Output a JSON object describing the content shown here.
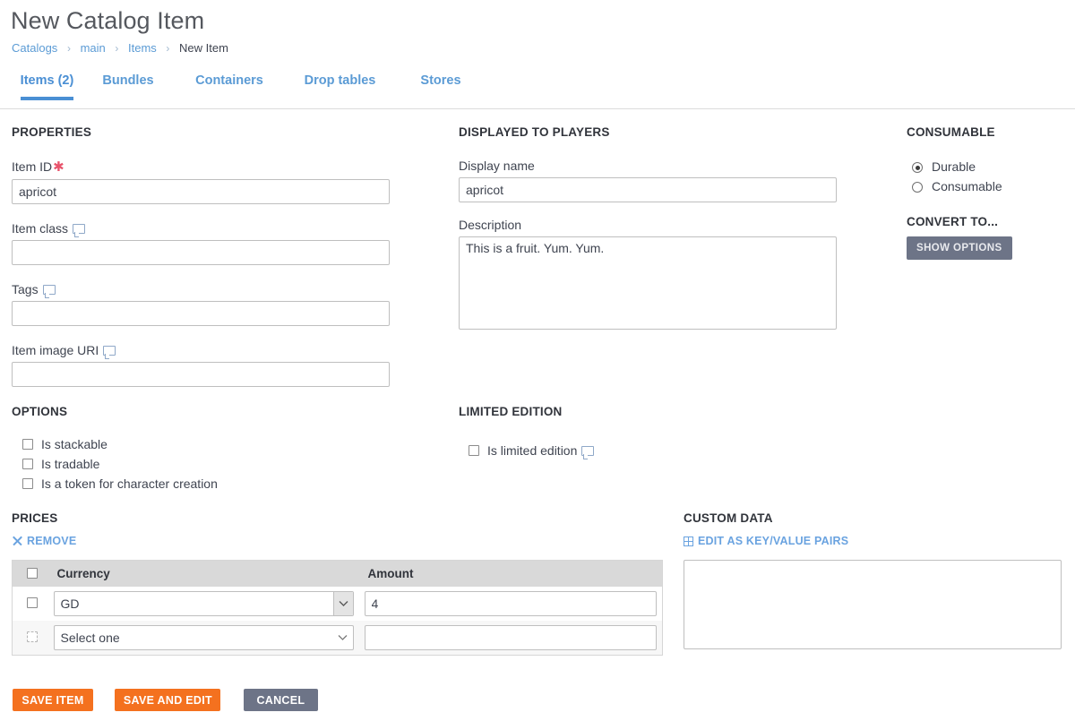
{
  "header": {
    "title": "New Catalog Item",
    "breadcrumb": [
      {
        "label": "Catalogs",
        "current": false
      },
      {
        "label": "main",
        "current": false
      },
      {
        "label": "Items",
        "current": false
      },
      {
        "label": "New Item",
        "current": true
      }
    ],
    "separator": "›",
    "tabs": [
      {
        "label": "Items (2)",
        "active": true
      },
      {
        "label": "Bundles",
        "active": false
      },
      {
        "label": "Containers",
        "active": false
      },
      {
        "label": "Drop tables",
        "active": false
      },
      {
        "label": "Stores",
        "active": false
      }
    ]
  },
  "properties": {
    "heading": "PROPERTIES",
    "item_id": {
      "label": "Item ID",
      "required_marker": "✱",
      "value": "apricot",
      "placeholder": ""
    },
    "item_class": {
      "label": "Item class",
      "value": "",
      "placeholder": "",
      "tooltip_icon": "tooltip-bubble-icon"
    },
    "tags": {
      "label": "Tags",
      "value": "",
      "placeholder": "",
      "tooltip_icon": "tooltip-bubble-icon"
    },
    "item_image_uri": {
      "label": "Item image URI",
      "value": "",
      "placeholder": "",
      "tooltip_icon": "tooltip-bubble-icon"
    }
  },
  "displayed_to_players": {
    "heading": "DISPLAYED TO PLAYERS",
    "display_name": {
      "label": "Display name",
      "value": "apricot",
      "placeholder": ""
    },
    "description": {
      "label": "Description",
      "value": "This is a fruit. Yum. Yum.",
      "placeholder": ""
    }
  },
  "consumable": {
    "heading": "CONSUMABLE",
    "options": [
      {
        "label": "Durable",
        "selected": true
      },
      {
        "label": "Consumable",
        "selected": false
      }
    ]
  },
  "convert_to": {
    "heading": "CONVERT TO...",
    "show_options_label": "SHOW OPTIONS"
  },
  "options": {
    "heading": "OPTIONS",
    "items": [
      {
        "label": "Is stackable",
        "checked": false
      },
      {
        "label": "Is tradable",
        "checked": false
      },
      {
        "label": "Is a token for character creation",
        "checked": false
      }
    ]
  },
  "limited_edition": {
    "heading": "LIMITED EDITION",
    "checkbox": {
      "label": "Is limited edition",
      "checked": false,
      "tooltip_icon": "tooltip-bubble-icon"
    }
  },
  "prices": {
    "heading": "PRICES",
    "remove_label": "REMOVE",
    "remove_icon": "close-x-icon",
    "columns": [
      "Currency",
      "Amount"
    ],
    "rows": [
      {
        "selected": false,
        "currency": "GD",
        "amount": "4",
        "disabled": false
      },
      {
        "selected": false,
        "currency": "Select one",
        "amount": "",
        "disabled": true
      }
    ],
    "currency_options": [
      "Select one",
      "GD"
    ]
  },
  "custom_data": {
    "heading": "CUSTOM DATA",
    "edit_label": "EDIT AS KEY/VALUE PAIRS",
    "edit_icon": "grid-table-icon",
    "value": "",
    "placeholder": ""
  },
  "footer": {
    "save_item_label": "SAVE ITEM",
    "save_and_edit_label": "SAVE AND EDIT",
    "cancel_label": "CANCEL"
  },
  "colors": {
    "accent_blue": "#4a8fd4",
    "link_blue": "#5b9bd5",
    "orange": "#f4711f",
    "slate": "#6d7487",
    "required_red": "#e8536b"
  }
}
